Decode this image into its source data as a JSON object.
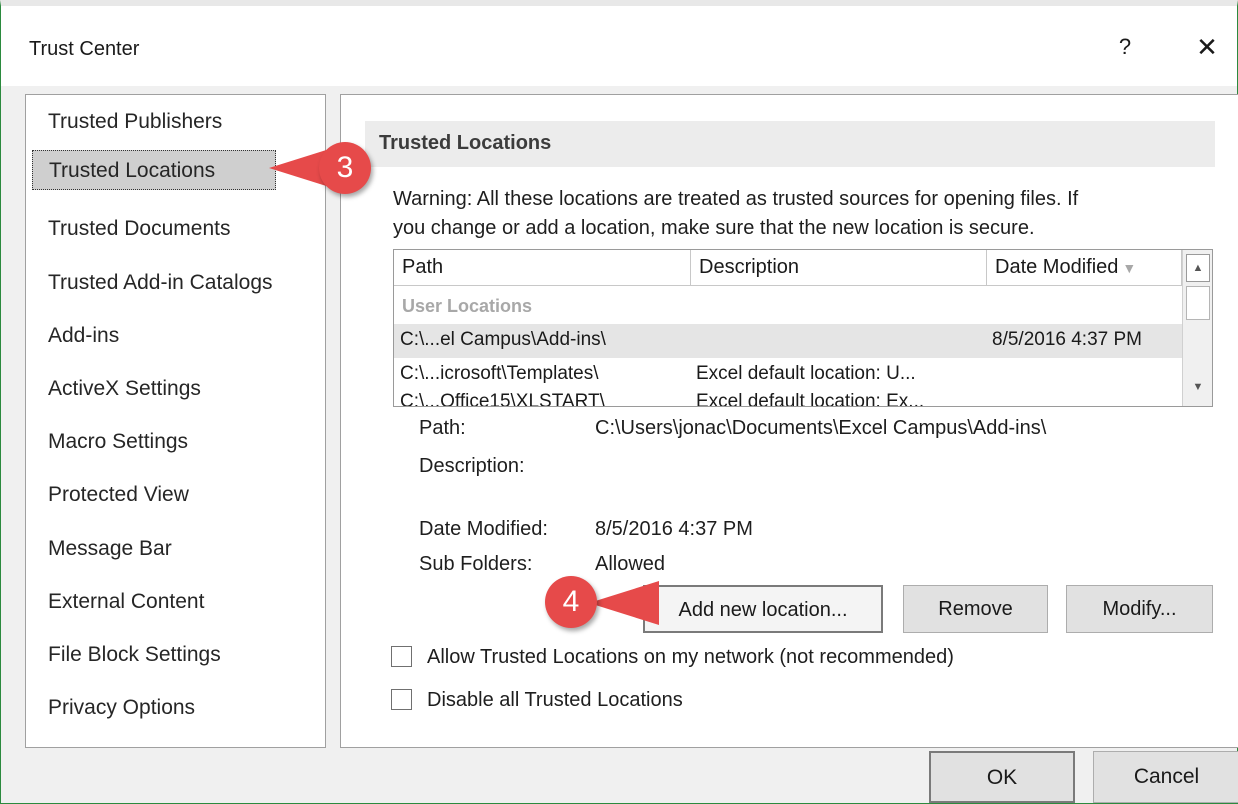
{
  "window": {
    "title": "Trust Center",
    "help_label": "?",
    "close_label": "✕"
  },
  "nav": {
    "items": [
      {
        "label": "Trusted Publishers"
      },
      {
        "label": "Trusted Locations",
        "selected": true
      },
      {
        "label": "Trusted Documents"
      },
      {
        "label": "Trusted Add-in Catalogs"
      },
      {
        "label": "Add-ins"
      },
      {
        "label": "ActiveX Settings"
      },
      {
        "label": "Macro Settings"
      },
      {
        "label": "Protected View"
      },
      {
        "label": "Message Bar"
      },
      {
        "label": "External Content"
      },
      {
        "label": "File Block Settings"
      },
      {
        "label": "Privacy Options"
      }
    ]
  },
  "content": {
    "section_title": "Trusted Locations",
    "warning_line1": "Warning: All these locations are treated as trusted sources for opening files.  If",
    "warning_line2": "you change or add a location, make sure that the new location is secure.",
    "grid": {
      "columns": [
        "Path",
        "Description",
        "Date Modified"
      ],
      "sort_indicator": "▼",
      "group_label": "User Locations",
      "rows": [
        {
          "path": "C:\\...el Campus\\Add-ins\\",
          "description": "",
          "date": "8/5/2016 4:37 PM"
        },
        {
          "path": "C:\\...icrosoft\\Templates\\",
          "description": "Excel default location: U...",
          "date": ""
        },
        {
          "path": "C:\\...Office15\\XLSTART\\",
          "description": "Excel default location: Ex...",
          "date": ""
        }
      ],
      "scroll_up": "▲",
      "scroll_down": "▼"
    },
    "details": {
      "path_label": "Path:",
      "path_value": "C:\\Users\\jonac\\Documents\\Excel Campus\\Add-ins\\",
      "description_label": "Description:",
      "description_value": "",
      "date_label": "Date Modified:",
      "date_value": "8/5/2016 4:37 PM",
      "subfolders_label": "Sub Folders:",
      "subfolders_value": "Allowed"
    },
    "buttons": {
      "add": "Add new location...",
      "remove": "Remove",
      "modify": "Modify..."
    },
    "checkboxes": {
      "allow_network": "Allow Trusted Locations on my network (not recommended)",
      "allow_network_checked": false,
      "disable_all": "Disable all Trusted Locations",
      "disable_all_checked": false
    }
  },
  "footer": {
    "ok": "OK",
    "cancel": "Cancel"
  },
  "callouts": {
    "step3": "3",
    "step4": "4",
    "color": "#e64a4a"
  }
}
